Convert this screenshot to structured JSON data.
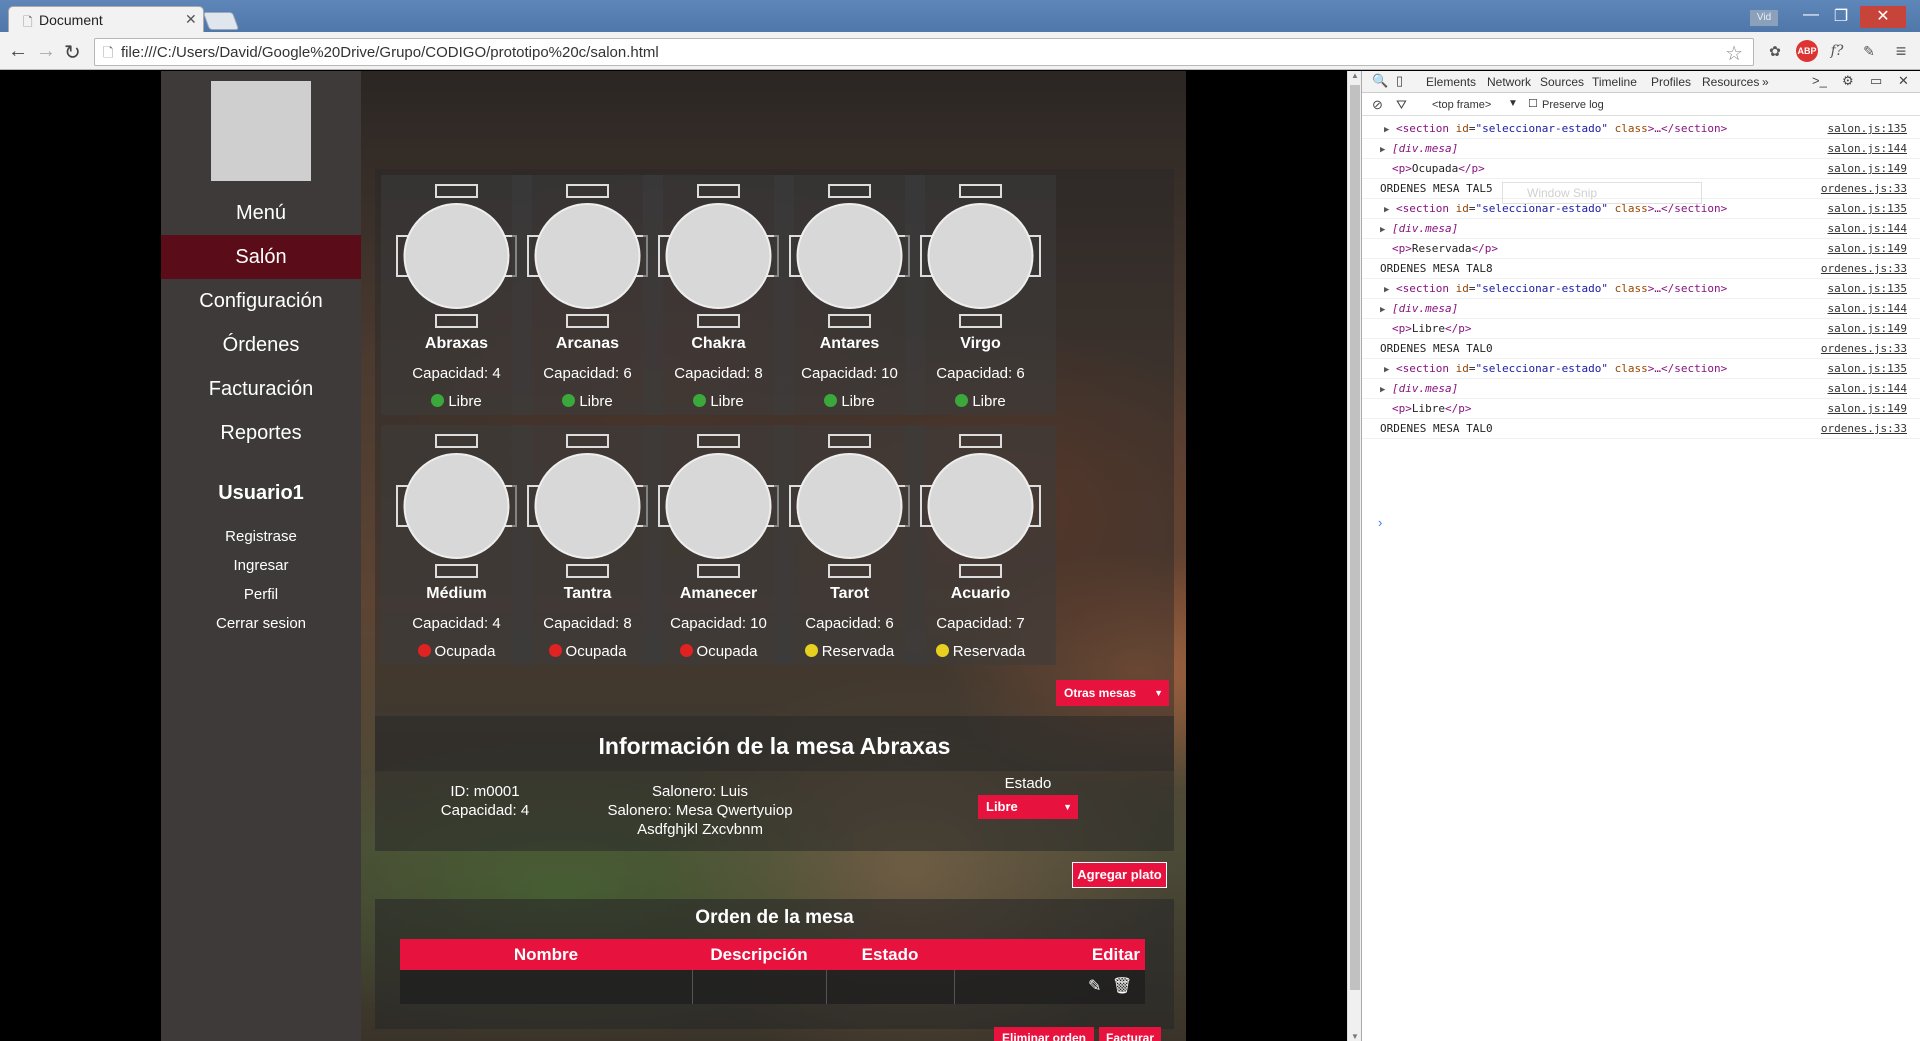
{
  "browser": {
    "tab_title": "Document",
    "url": "file:///C:/Users/David/Google%20Drive/Grupo/CODIGO/prototipo%20c/salon.html",
    "user_badge": "Vid"
  },
  "sidebar": {
    "nav": [
      {
        "label": "Menú",
        "active": false
      },
      {
        "label": "Salón",
        "active": true
      },
      {
        "label": "Configuración",
        "active": false
      },
      {
        "label": "Órdenes",
        "active": false
      },
      {
        "label": "Facturación",
        "active": false
      },
      {
        "label": "Reportes",
        "active": false
      }
    ],
    "user": {
      "name": "Usuario1",
      "links": [
        "Registrase",
        "Ingresar",
        "Perfil",
        "Cerrar sesion"
      ]
    }
  },
  "mesas": [
    {
      "name": "Abraxas",
      "capacity": "Capacidad: 4",
      "status": "Libre",
      "status_color": "#3aa83a"
    },
    {
      "name": "Arcanas",
      "capacity": "Capacidad: 6",
      "status": "Libre",
      "status_color": "#3aa83a"
    },
    {
      "name": "Chakra",
      "capacity": "Capacidad: 8",
      "status": "Libre",
      "status_color": "#3aa83a"
    },
    {
      "name": "Antares",
      "capacity": "Capacidad: 10",
      "status": "Libre",
      "status_color": "#3aa83a"
    },
    {
      "name": "Virgo",
      "capacity": "Capacidad: 6",
      "status": "Libre",
      "status_color": "#3aa83a"
    },
    {
      "name": "Médium",
      "capacity": "Capacidad: 4",
      "status": "Ocupada",
      "status_color": "#e02222"
    },
    {
      "name": "Tantra",
      "capacity": "Capacidad: 8",
      "status": "Ocupada",
      "status_color": "#e02222"
    },
    {
      "name": "Amanecer",
      "capacity": "Capacidad: 10",
      "status": "Ocupada",
      "status_color": "#e02222"
    },
    {
      "name": "Tarot",
      "capacity": "Capacidad: 6",
      "status": "Reservada",
      "status_color": "#e8d020"
    },
    {
      "name": "Acuario",
      "capacity": "Capacidad: 7",
      "status": "Reservada",
      "status_color": "#e8d020"
    }
  ],
  "controls": {
    "otras_mesas": "Otras mesas",
    "agregar_plato": "Agregar plato",
    "eliminar_orden": "Eliminar orden",
    "facturar": "Facturar"
  },
  "info": {
    "title": "Información de la mesa Abraxas",
    "id": "ID: m0001",
    "capacidad": "Capacidad: 4",
    "salonero": "Salonero: Luis",
    "salonero2": "Salonero: Mesa Qwertyuiop",
    "salonero3": "Asdfghjkl Zxcvbnm",
    "estado_label": "Estado",
    "estado_value": "Libre"
  },
  "orden": {
    "title": "Orden de la mesa",
    "columns": [
      "Nombre",
      "Descripción",
      "Estado",
      "Editar"
    ]
  },
  "devtools": {
    "tabs": [
      "Elements",
      "Network",
      "Sources",
      "Timeline",
      "Profiles",
      "Resources"
    ],
    "frame": "<top frame>",
    "preserve_log": "Preserve log",
    "ghost": "Window Snip",
    "log": [
      {
        "kind": "section",
        "src": "salon.js:135"
      },
      {
        "kind": "div",
        "src": "salon.js:144"
      },
      {
        "kind": "p",
        "text": "Ocupada",
        "src": "salon.js:149"
      },
      {
        "kind": "plain",
        "text": "ORDENES MESA TAL5",
        "src": "ordenes.js:33"
      },
      {
        "kind": "section",
        "src": "salon.js:135"
      },
      {
        "kind": "div",
        "src": "salon.js:144"
      },
      {
        "kind": "p",
        "text": "Reservada",
        "src": "salon.js:149"
      },
      {
        "kind": "plain",
        "text": "ORDENES MESA TAL8",
        "src": "ordenes.js:33"
      },
      {
        "kind": "section",
        "src": "salon.js:135"
      },
      {
        "kind": "div",
        "src": "salon.js:144"
      },
      {
        "kind": "p",
        "text": "Libre",
        "src": "salon.js:149"
      },
      {
        "kind": "plain",
        "text": "ORDENES MESA TAL0",
        "src": "ordenes.js:33"
      },
      {
        "kind": "section",
        "src": "salon.js:135"
      },
      {
        "kind": "div",
        "src": "salon.js:144"
      },
      {
        "kind": "p",
        "text": "Libre",
        "src": "salon.js:149"
      },
      {
        "kind": "plain",
        "text": "ORDENES MESA TAL0",
        "src": "ordenes.js:33"
      }
    ]
  }
}
